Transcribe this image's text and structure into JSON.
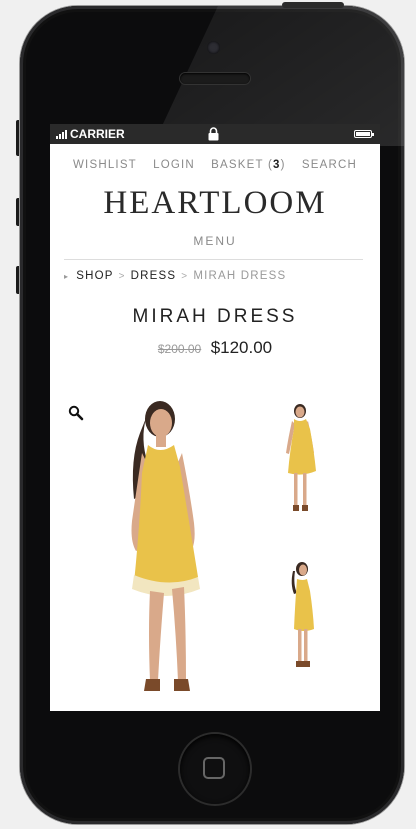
{
  "status_bar": {
    "carrier": "CARRIER"
  },
  "top_nav": {
    "wishlist": "WISHLIST",
    "login": "LOGIN",
    "basket_label": "BASKET",
    "basket_open": "(",
    "basket_count": "3",
    "basket_close": ")",
    "search": "SEARCH"
  },
  "brand": {
    "logo": "HEARTLOOM"
  },
  "menu_label": "MENU",
  "breadcrumb": {
    "shop": "SHOP",
    "sep1": ">",
    "dress": "DRESS",
    "sep2": ">",
    "current": "MIRAH DRESS"
  },
  "product": {
    "title": "MIRAH DRESS",
    "old_price": "$200.00",
    "new_price": "$120.00"
  },
  "colors": {
    "dress": "#e9c24a",
    "skin": "#d9a98a",
    "hair": "#3a2a22",
    "phone_body": "#0c0c0d"
  },
  "icons": {
    "zoom": "magnifier-icon",
    "lock": "lock-icon",
    "battery": "battery-icon",
    "signal": "signal-icon",
    "home": "home-button-icon"
  }
}
